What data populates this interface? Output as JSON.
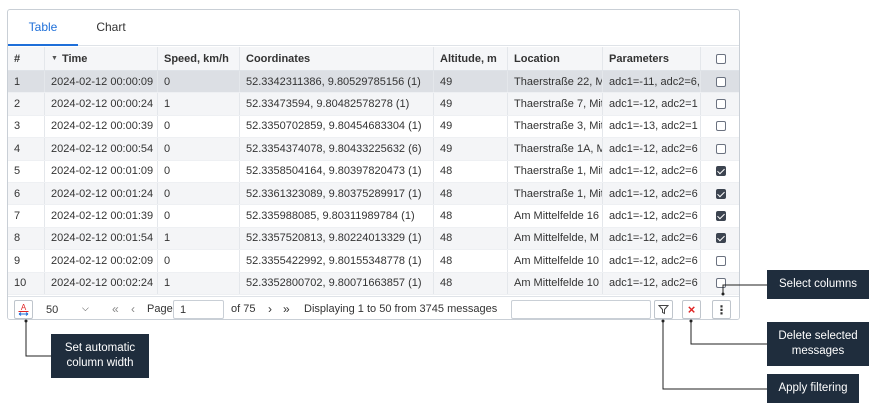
{
  "tabs": [
    {
      "label": "Table",
      "active": true
    },
    {
      "label": "Chart",
      "active": false
    }
  ],
  "table": {
    "headers": [
      "#",
      "Time",
      "Speed, km/h",
      "Coordinates",
      "Altitude, m",
      "Location",
      "Parameters",
      ""
    ],
    "sort_column": "Time",
    "rows": [
      {
        "n": "1",
        "time": "2024-02-12 00:00:09",
        "speed": "0",
        "coords": "52.3342311386, 9.80529785156 (1)",
        "alt": "49",
        "loc": "Thaerstraße 22, M",
        "params": "adc1=-11, adc2=6,",
        "checked": false,
        "selected": true
      },
      {
        "n": "2",
        "time": "2024-02-12 00:00:24",
        "speed": "1",
        "coords": "52.33473594, 9.80482578278 (1)",
        "alt": "49",
        "loc": "Thaerstraße 7, Mit",
        "params": "adc1=-12, adc2=1",
        "checked": false,
        "selected": false
      },
      {
        "n": "3",
        "time": "2024-02-12 00:00:39",
        "speed": "0",
        "coords": "52.3350702859, 9.80454683304 (1)",
        "alt": "49",
        "loc": "Thaerstraße 3, Mit",
        "params": "adc1=-13, adc2=1",
        "checked": false,
        "selected": false
      },
      {
        "n": "4",
        "time": "2024-02-12 00:00:54",
        "speed": "0",
        "coords": "52.3354374078, 9.80433225632 (6)",
        "alt": "49",
        "loc": "Thaerstraße 1A, M",
        "params": "adc1=-12, adc2=6",
        "checked": false,
        "selected": false
      },
      {
        "n": "5",
        "time": "2024-02-12 00:01:09",
        "speed": "0",
        "coords": "52.3358504164, 9.80397820473 (1)",
        "alt": "48",
        "loc": "Thaerstraße 1, Mit",
        "params": "adc1=-12, adc2=6",
        "checked": true,
        "selected": false
      },
      {
        "n": "6",
        "time": "2024-02-12 00:01:24",
        "speed": "0",
        "coords": "52.3361323089, 9.80375289917 (1)",
        "alt": "48",
        "loc": "Thaerstraße 1, Mit",
        "params": "adc1=-12, adc2=6",
        "checked": true,
        "selected": false
      },
      {
        "n": "7",
        "time": "2024-02-12 00:01:39",
        "speed": "0",
        "coords": "52.335988085, 9.80311989784 (1)",
        "alt": "48",
        "loc": "Am Mittelfelde 16",
        "params": "adc1=-12, adc2=6",
        "checked": true,
        "selected": false
      },
      {
        "n": "8",
        "time": "2024-02-12 00:01:54",
        "speed": "1",
        "coords": "52.3357520813, 9.80224013329 (1)",
        "alt": "48",
        "loc": "Am Mittelfelde, M",
        "params": "adc1=-12, adc2=6",
        "checked": true,
        "selected": false
      },
      {
        "n": "9",
        "time": "2024-02-12 00:02:09",
        "speed": "0",
        "coords": "52.3355422992, 9.80155348778 (1)",
        "alt": "48",
        "loc": "Am Mittelfelde 10",
        "params": "adc1=-12, adc2=6",
        "checked": false,
        "selected": false
      },
      {
        "n": "10",
        "time": "2024-02-12 00:02:24",
        "speed": "1",
        "coords": "52.3352800702, 9.80071663857 (1)",
        "alt": "48",
        "loc": "Am Mittelfelde 10",
        "params": "adc1=-12, adc2=6",
        "checked": false,
        "selected": false
      }
    ]
  },
  "footer": {
    "per_page": "50",
    "page_label": "Page",
    "page_value": "1",
    "of_label": "of 75",
    "displaying": "Displaying 1 to 50 from 3745 messages",
    "autowidth_icon_letter": "A",
    "first_glyph": "«",
    "prev_glyph": "‹",
    "next_glyph": "›",
    "last_glyph": "»",
    "delete_glyph": "×",
    "columns_glyph": "⋮"
  },
  "callouts": {
    "autowidth": "Set automatic column width",
    "columns": "Select columns",
    "delete": "Delete selected messages",
    "filter": "Apply filtering"
  },
  "colors": {
    "accent": "#1e6fd9",
    "callout_bg": "#1f2d3d",
    "delete_red": "#e02424"
  }
}
